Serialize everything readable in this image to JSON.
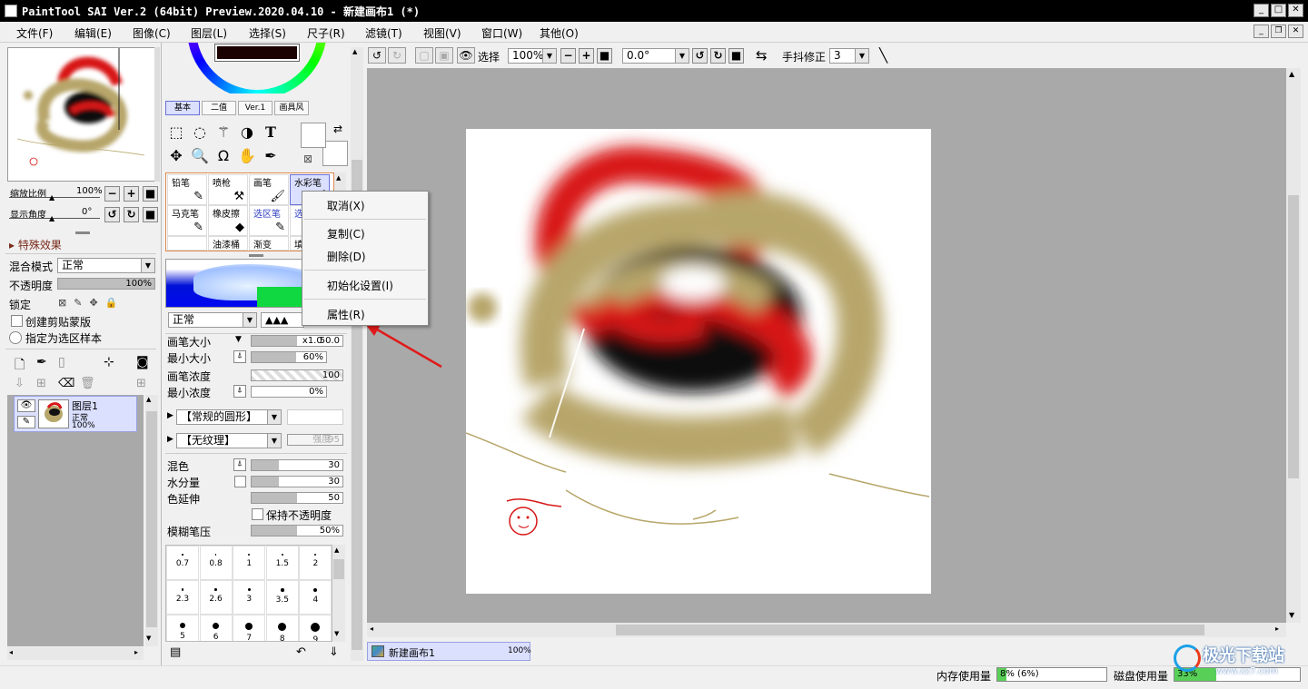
{
  "window": {
    "title": "PaintTool SAI Ver.2 (64bit) Preview.2020.04.10 - 新建画布1 (*)"
  },
  "menu": [
    "文件(F)",
    "编辑(E)",
    "图像(C)",
    "图层(L)",
    "选择(S)",
    "尺子(R)",
    "滤镜(T)",
    "视图(V)",
    "窗口(W)",
    "其他(O)"
  ],
  "navigator": {
    "zoom_label": "缩放比例",
    "zoom_value": "100%",
    "angle_label": "显示角度",
    "angle_value": "0°"
  },
  "layer_panel": {
    "effects_label": "特殊效果",
    "blend_label": "混合模式",
    "blend_value": "正常",
    "opacity_label": "不透明度",
    "opacity_value": "100%",
    "lock_label": "锁定",
    "clip_label": "创建剪贴蒙版",
    "selection_sample_label": "指定为选区样本",
    "layer": {
      "name": "图层1",
      "mode": "正常",
      "opacity": "100%"
    }
  },
  "tool_tabs": [
    "基本",
    "二值",
    "Ver.1",
    "画具风"
  ],
  "brushes": [
    {
      "name": "铅笔"
    },
    {
      "name": "喷枪"
    },
    {
      "name": "画笔"
    },
    {
      "name": "水彩笔"
    },
    {
      "name": "马克笔"
    },
    {
      "name": "橡皮擦"
    },
    {
      "name": "选区笔"
    },
    {
      "name": "选"
    },
    {
      "name": ""
    },
    {
      "name": "油漆桶"
    },
    {
      "name": "渐变"
    },
    {
      "name": "填"
    }
  ],
  "brush_settings": {
    "mode_value": "正常",
    "size_label": "画笔大小",
    "size_mult": "x1.0",
    "size_value": "50.0",
    "min_size_label": "最小大小",
    "min_size_value": "60%",
    "density_label": "画笔浓度",
    "density_value": "100",
    "min_density_label": "最小浓度",
    "min_density_value": "0%",
    "shape_value": "【常规的圆形】",
    "texture_value": "【无纹理】",
    "texture_strength": "强度",
    "texture_strength_value": "95",
    "blend_label": "混色",
    "blend_value": "30",
    "water_label": "水分量",
    "water_value": "30",
    "stretch_label": "色延伸",
    "stretch_value": "50",
    "keep_opacity_label": "保持不透明度",
    "blur_label": "模糊笔压",
    "blur_value": "50%"
  },
  "brush_sizes": [
    "0.7",
    "0.8",
    "1",
    "1.5",
    "2",
    "2.3",
    "2.6",
    "3",
    "3.5",
    "4",
    "5",
    "6",
    "7",
    "8",
    "9"
  ],
  "context_menu": [
    "取消(X)",
    "复制(C)",
    "删除(D)",
    "初始化设置(I)",
    "属性(R)"
  ],
  "toolbar": {
    "select_label": "选择",
    "zoom_value": "100%",
    "angle_value": "0.0°",
    "stabilizer_label": "手抖修正",
    "stabilizer_value": "3"
  },
  "canvas_tab": {
    "name": "新建画布1",
    "zoom": "100%"
  },
  "status": {
    "memory_label": "内存使用量",
    "memory_value": "8% (6%)",
    "disk_label": "磁盘使用量",
    "disk_value": "33%"
  },
  "watermark": {
    "text": "极光下载站",
    "url": "www.xz7.com"
  },
  "colors": {
    "red": "#d81616",
    "khaki": "#b7a66a",
    "selection_blue": "#dbe0ff",
    "canvas_bg": "#a9a9a9"
  }
}
